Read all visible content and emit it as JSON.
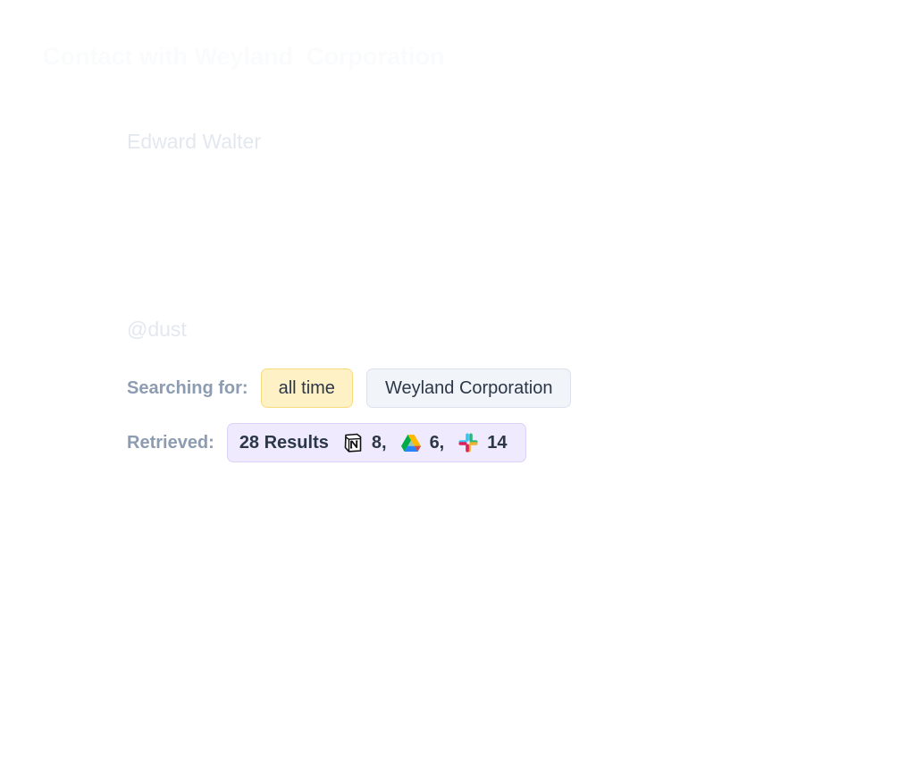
{
  "header": {
    "title": "Contact with Weyland  Corporation"
  },
  "message": {
    "author": "Edward Walter",
    "mention": "@dust"
  },
  "search": {
    "label": "Searching for:",
    "time_filter": "all time",
    "query": "Weyland Corporation"
  },
  "retrieved": {
    "label": "Retrieved:",
    "total": "28 Results",
    "sources": [
      {
        "icon": "notion-icon",
        "count": "8,"
      },
      {
        "icon": "google-drive-icon",
        "count": "6,"
      },
      {
        "icon": "slack-icon",
        "count": "14"
      }
    ]
  },
  "colors": {
    "time_chip_bg": "#fdf1c5",
    "query_chip_bg": "#f1f4f9",
    "results_chip_bg": "#efeafd",
    "label_text": "#8d9cb1"
  }
}
